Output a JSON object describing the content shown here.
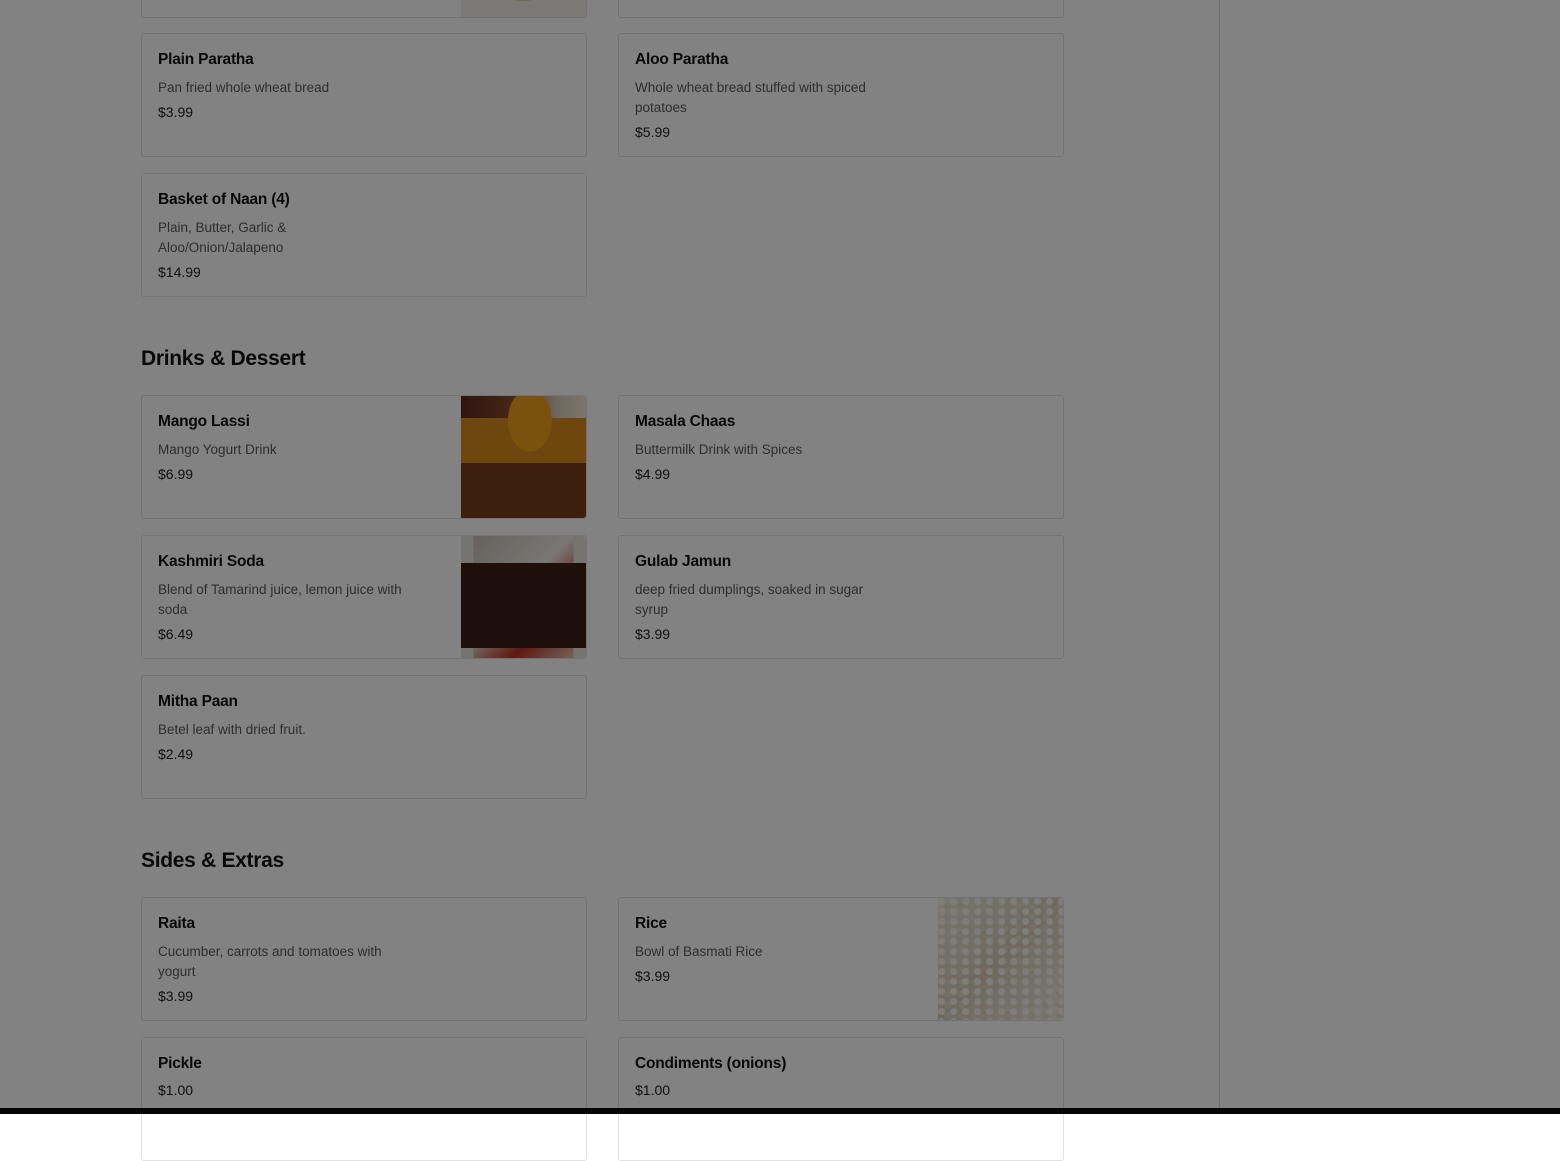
{
  "sections": {
    "drinks_title": "Drinks & Dessert",
    "sides_title": "Sides & Extras"
  },
  "breads": [
    {
      "name": "Plain Paratha",
      "description": "Pan fried whole wheat bread",
      "price": "$3.99"
    },
    {
      "name": "Aloo Paratha",
      "description": "Whole wheat bread stuffed with spiced potatoes",
      "price": "$5.99"
    },
    {
      "name": "Basket of Naan (4)",
      "description": "Plain, Butter, Garlic & Aloo/Onion/Jalapeno",
      "price": "$14.99"
    }
  ],
  "drinks": [
    {
      "name": "Mango Lassi",
      "description": "Mango Yogurt Drink",
      "price": "$6.99",
      "image": "mango-lassi-photo"
    },
    {
      "name": "Masala Chaas",
      "description": "Buttermilk Drink with Spices",
      "price": "$4.99"
    },
    {
      "name": "Kashmiri Soda",
      "description": "Blend of Tamarind juice, lemon juice with soda",
      "price": "$6.49",
      "image": "kashmiri-soda-photo"
    },
    {
      "name": "Gulab Jamun",
      "description": "deep fried dumplings, soaked in sugar syrup",
      "price": "$3.99"
    },
    {
      "name": "Mitha Paan",
      "description": "Betel leaf with dried fruit.",
      "price": "$2.49"
    }
  ],
  "sides": [
    {
      "name": "Raita",
      "description": "Cucumber, carrots and tomatoes with yogurt",
      "price": "$3.99"
    },
    {
      "name": "Rice",
      "description": "Bowl of Basmati Rice",
      "price": "$3.99",
      "image": "rice-photo"
    },
    {
      "name": "Pickle",
      "price": "$1.00"
    },
    {
      "name": "Condiments (onions)",
      "price": "$1.00"
    }
  ],
  "colors": {
    "overlay": "#000000",
    "text": "#111111",
    "border": "#e1e1e1"
  }
}
